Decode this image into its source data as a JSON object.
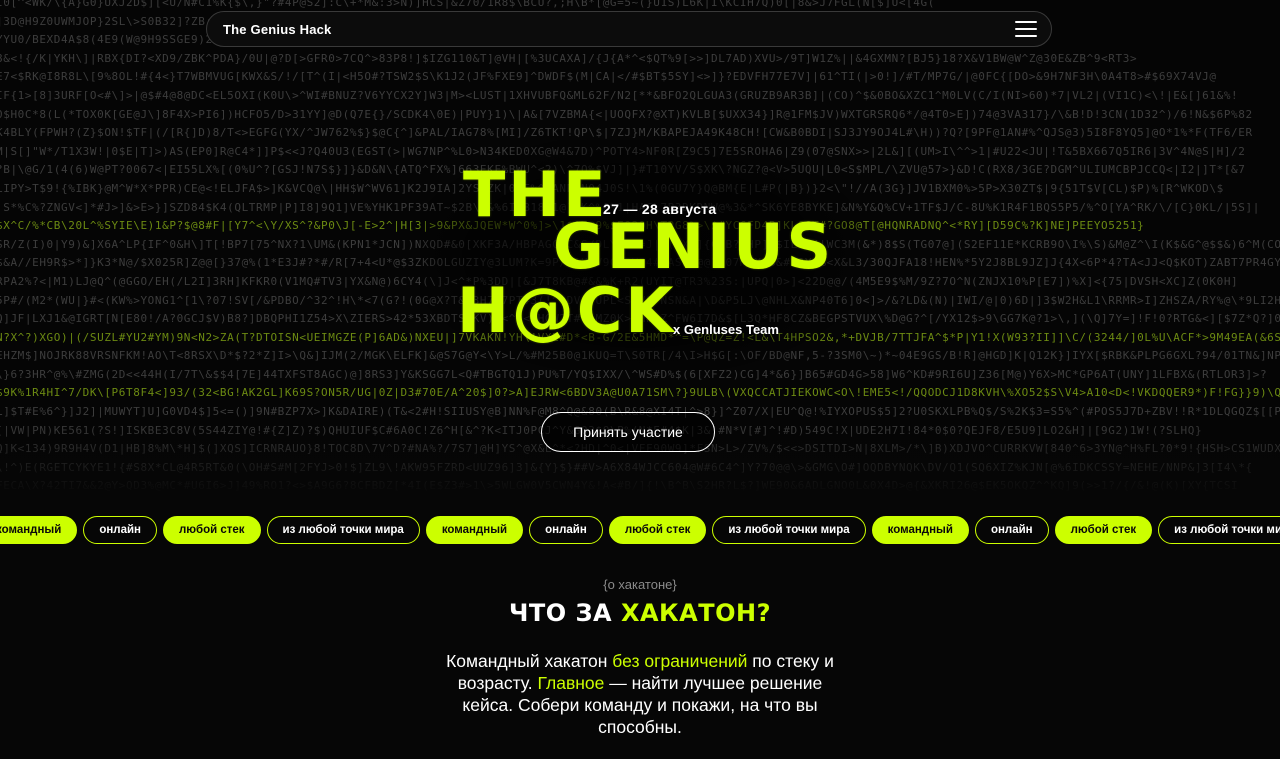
{
  "hero": {
    "matrix_lines": [
      "I0[^<WK/\\{A}G0}UXJ2D$][<U/N#C1%K{$\\,}\"?#4P@S2]:C\\+*M&:3>N)]HCS|&Z70/1R8$\\BCU?,;H\\B*[@G=5~(}U1S)L6K|I\\KCIH7Q)0[|8&>J7FGL(N[$]U<[4G(",
      "]3D@H9Z0UWMJOP}2SL\\>S0B32]?ZB;&!NF3\\&}@3W<XR\"7?1W\"<ZW\\1DD7L+%>R4}\\L%!?94#2D_J78*@OH)&{|2S;8H?C64&##B\\]W}K3#)QU8/]P$,<C<V%B7CD1XE]U{",
      "YYU0/BEXD4A$8(4E9(W@9H9SSGE9)2B<W%=[^U4!H&J8HGX\"@XF%<X%77|!\\%9>T;&@0[&N;8QE#&H5}=R4)@H(~80/P\\)@P/?0@<&>S08V!NCL17[3)7//0)UDH57MTS>",
      "8&<!{/K|YKH\\]|RBX{DI?<XD9/ZBK^PDA}/0U|@?D[>GFR0>7CQ^>83P8!]$IZG110&T]@VH|[%3UCAXA]/{J{A*^<$QT%9[>>]DL7AD)XVU>/9T]W1Z%||&4GXMN?[BJ5}18?X&V1BW@W^Z@30E&ZB^9<RT3>",
      "E7<$RK@I8R8L\\[9%8OL!#{4<}T7WBMVUG[KWX&S/!/[T^(I|<H5O#?TSW2$S\\K1J2(JF%FXE9]^DWDF$(M|CA|</#$BT$5SY]<>]}?EDVFH77E7V]|61^TI(|>0!]/#T/MP7G/|@0FC{[DO>&9H7NF3H\\0A4T8>#$69X74VJ@",
      "IF{1>[8]3URF[O<#\\]>|@$#4@8@DC<EL5OXI(K0U\\>^WI#BNUZ?V6YYCX2Y]W3|M><LUST|1XHVUBFQ&ML62F/N2[**&BFO2QLGUA3(GRUZB9AR3B]|(CO)^$&0BO&XZC1^M0LV(C/I(NI>60)*7|VL2|(VI1C)<\\!|E&[]61&%!",
      "0$H0C*8(L(*TOX0K[GE@J\\]8F4X>PI6])HCFO5/D>31YY]@D(Q7E{}/SCDK4\\0E)|PUY}1)\\|A&[7VZBMA{<|UOQFX?@XT)KVLB[$UXX34}]R@1FM$JV)WXTGRSRQ6*/@4T0>E])74@3VA317}/\\&B!D!3CN(1D32^)/6!N&$6P%82",
      "K4BLY(FPWH?(Z}$ON!$TF|(/[R{]D)8/T<>EGFG(YX/^JW762%$}$@C{^]&PAL/IAG78%[MI]/Z6TKT!QP\\$|7ZJ}M/KBAPEJA49K48CH![CW&B0BDI|SJ3JY9OJ4L#\\H))?Q?[9PF@1AN#%^QJS@3)5I8F8YQ5]@O*1%*F(TF6/ER",
      "M|S[]\"W*/T1X3W!|0$E|T]>)AS(EP0]R@C4*]]P$<<J?Q40U3(EGST(>|WG7NP^%L0>N34KED0XG@W4&7D)^POTY4>NF0R[Z9C5]7E5SROHA6|Z9(07@SNX>>|2L&][(UM>I\\^^>1|#U22<JU|!T&5BX667Q5IR6|3V^4N@S|H]/2",
      "?B|\\@G/1(4(6)W@PT?0067<|EI55LX%[(0%U^?[GSJ!N7S$}]}&D&N\\{ATQ^FX%]663EKF%BWU^<2)\\^7Q%$VJ]|}#T10YV/S$XK\\?NGZ?@<V>5UQU|L0<S$MPL/\\ZVU@57>}&D!C(RX8/3GE?DGM^ULIUMCBPJCCQ<|I2|]T*[&7",
      "LIPY>T$9!{%IBK}@M^W*X*PPR)CE@<!ELJFA$>]K&VCQ@\\|HH$W^WV61]K2J9IA]2YSDZK|03F%^&ANPVN04J0S!\\1%(0GU7Y}Q@BM{E|L#P(|B})}2<\\\"!//A(3G}]JV1BXM0%>5P>X30ZT$|9{51T$V[CL)$P)%[R^WKOD\\$",
      "|S*%C%?ZNGV<]*#J>]&>E>}]SZD84$K4(QLTRMP|P]I8]9Q1]VE%YHK1PF39AT~$2B\\7&%6I1B18C1@]AK^%0%1|HAC\\7B3DKDNW@%3&*^SK6YE8BYKE]&N%Y&Q%CV+1TF$J/C-8U%K1R4F1BQS5P5/%^O[YA^RK/\\/[C}0KL/|5S]|",
      "$X^C/%*CB\\20L^%SYIE\\E)1&P?$@8#F|[Y7^<\\Y/XS^?&P0\\J[-E>2^|H[3|>9&PX&JQEW*W^0%]>\\1$A7@9%$E02OH\\TRG8%>\\$#YC6FD4B]KLG6T#?GO8@T[@HQNRADNQ^<*RY][D59C%?K]NE]PEEYO5251}",
      "SR/Z(I)0|Y9)&]X6A^LP{IF^0&H\\]T[!BP7[75^NX?1\\UM&(KPN1*JCN])NXQD#&0[XKF3A/HBPAGCUC&S/DLYBRU=J|O(XXY]{CTB?(HP]U$IL8@4|WC3M(&*)8$S(TG07@](S2EF11E*KCRB9O\\I%\\S)&M@Z^\\I(K$&G^@$$&)6^M(CO5AO}",
      "$&A//EH9R$>*]}K3*N@/$X025R]Z@@[}37@%(1*E3J#?*#/R[7+4<U*@$3ZKDOLGUZIY@3LUM?K=9P/#&UMV9C@PV54#[ASEV@@?G07M}X@S&#M2Y@%<X&L3/30QJFA18!HEN%*5Y2J8BL9JZ]J{4X<6P*4?TA<JJ<Q$KOT)ZABT7PR4GYC]\\TI]Z|3SJZ",
      "RPA2%?<|M1)LJ@Q^(@GGO/EH(/L2I]3RH]KFKR0(V1MQ#TV3|YX&N@)6CY4(\\]J<^*P%3DD|[&J7T8KB@#&&%K+R2(UYIT@TR3%23S:|UPQ|0>]<22D@@/(4M5E9$%M/9Z?7O^N(ZNJX10%P[E7])%X]<{75|DVSH<XC]Z(0K0H]",
      "5P#/(M2*(WU|}#<(KW%>YONG1^[1\\?07!SV[/&PDBO/^32^!H\\*<7(G?!(0G@X?T&L3H7J7PT#3(!^*DV+)UPL<S8V9PNSN&A|\\D&P5LJ\\@NHLX&NP40T6]0<]>/&?LD&(N)|IWI/@|0)6D|]3$W2H&L1\\RRMR>I]ZHSZA/RY%@\\*9LI2H!",
      "Q]JF|LXJ1&@IGRT[N[E80!/A?0GCJ$V)B8?]DBQPHI1Z54>X\\ZIERS>42*53XBDTSHKV)9<^-<BHGW2T#Q(MZ0K>LH#]Z^FW6I7D&$[L3Q*HF8CZ&BEGPSTVUX\\%D@G?^[/YX12$>9\\GG7K@?1>\\,](\\Q]7Y=]!F!0?RTG&<][$7Z*Q?]02P{%<)>$C?C",
      "N?X^?)XGO)|(/SUZL#YU2#YM)9N<N2>ZA(T?DTOISN<UEIMGZE(P]6AD&)NXEU|]7VKAKN!YH\\!VXE#D*<B-G/2E&5HMD*^=\\P@QZ=Z!<L&\\T4HPSO2&,*+DVJB/7TTJFA^$*P|Y1!X(W93?II]]\\C/(3244/]0L%U\\ACF*>9M49EA(&6SR[L!]QGP)MCPB$Z(",
      "EHZM$]NOJRK88VRSNFKM!AO\\T<8RSX\\D*$?2*Z]I>\\Q&]IJM(2/MGK\\ELFK]&@S7G@Y<\\Y>L/%#M25B0@1KUQ=T\\S0TR[/4\\I>H$G[:\\OF/BD@NF,5-?3SM0\\~)*~04E9GS/B!R]@HGD]K|Q12K}]IYX[$RBK&PLPG6GXL?94/01TN&]NP(G4}EL]!{EK7E(OX/4P",
      "\\}6?3HR^@%\\#ZMG(2D<<44H(I/7T\\&$$4[7E]44TXFST8AGC)@]8RS3]Y&KSGG7L<Q#TBGTQ1J)PU%T/YQ$IXX/\\^WS#D%$(6[XFZ2)CG]4*&6}]B65#GD4G>58]W6^KD#9RI6U]Z36[M@)Y6X>MC*GP6AT(UNY]1LFBX&(RTLOR3]>?",
      "$9K%1R4HI^7/DK\\[P6T8F4<]93/(32<BG!AK2GL]K69S?ON5R/UG|0Z|D3#70E/A^20$]0?>A]EJRW<6BDV3A@U0A71SM\\?}9ULB\\(VXQCCATJIEKOWC<O\\!EME5<!/QQODCJ1D8KVH\\%XO52$S\\V4>A10<D<!VKDQQER9*)F!FG}}9)\\Q?P",
      "L]$T#E%6^}]J2]|MUWYT]U]G0VD4$]5<=()]9N#BZP7X>]K&DAIRE)(T&<2#H!SIIUSY@B]NN%F@M8^Q@&80(B\\R&8@XI4T|^>8}]^Z07/X|EU^Q@!%IYXOPUS$5]2?U0SKXLPB%Q$/S%2K$3=S5%^(#POS5J7D+ZBV!!R*1DLQGQZ$[[PHD(]",
      "[|VW|PN)KE561(?S!]ISKBE3C8V(5S44ZIY@!#{Z]Z)?$)QHUIUF$C#6A0C!Z6^H[&^?K<ITJ0PCJ^Y&GO3$Q\\P%(N*E#4$K|3&!#N*V[#]^!#D)549C!X|UDE2H7I!84*0$0?QEJF8/E5U9]LO2&H]|[9G2)1W!(?SLHQ}",
      "Q]K<134)9R9H4V(D1|HB]8%M\\*H]$(]XQS]ICRNRAUO}8!TOC8D\\7V^D?#NA%?/7S7]@H]YS^@X&L^*<?HD|^0<|VFF90W9]*FSN>L>/ZV%/$<<>DSITDI>N|8XLM>/*\\]B)XDJVO^CURRKVW[840^6>3YN@^H%FL?0*9!{HSH>CS1WUDXW",
      "\\!^)E(RGETCYKYE1!{#S8X*CL@4R5RT&0(\\OH#S#M[2FYJ>0!$]ZL9\\!AKW95FZRD<UUZ96]3]&{Y}$}##V>A6X84WJCC604@W#6C4^]Y?70@@\\>&GMG\\O#]OQDBYNQK\\DV/Q1(SQ6XIZ%KJN[@%6IDKCSSY=NEHE/NNP&]3[I4\\*{",
      "FECA\\X?42TI7&&2@Y>QD3%@MC*#U6I6>J]49%RO1?<>$A9G6?8CFBDZ[*4I(E$Z3#>1\\>5WLGW0V5CWN4Y&!A<#B/]{!\\B^B\\S2HR?L$?]WE90&6ADLGNO0L&0X4D>@{&XKRI26@$EK5OKQZ^^KQ]9(>>1?/{/&!@(K)[XY{TCSI",
      "Z%M&E)Y)0|/U3XX4@4HUASH&\\92]4OL!&P@@JDWU)/XV8GM8<F8II7!U[!WCFWS\\<JZL]?^54P[(5@JWRC]14E]$5[SZ]%[[FN05TE|8[S31!<YQK]EB)6\\#TP]$/ESIZ1ZAM<(DNQ*<C]@00@L)!GBFMFY#0!E/C<(|[%*&\\M*YH",
      "^%%SW}@SSVLJC8EMRJU626QN>?T!K\\ONRKM3#BI3@7DG|8K*&A@\\7)D#1BF/48PU&#)NLKX%D)T>M(G%O$B(U$TV[4MD0431B[?7Z1/2PIGRMB30(<[4<0!%J0<<A7%G@B&H]>JA^P5FV]GO*?4(0FVP\\&4B^3VF#UQK39ER$*/V*$",
      "A\\A4D*]VIN*$8K7{/A8Z(?L^A[QH%%@@GVV8^^?D4G]7MII[C@73I85XGJ716XU2NP/VY$G|K@0G-E2DS3RIX3XXJ62]FUR96(X3EBWY@RLMC4@#VM[TA&GQJ@>(0\\?[H(&GW]]M[05U?HKQVQ(?KW9N8>]WQFLSD&PW^YQ(#&QL)%3@$E",
      "JITGZZLBIM]3*87MZ]{/J{YM!S%NVQB%7UO@^OP@@U%X11HR2YV04G%07%(1TPUFP4[GMMWD\\4IU{FG\\NQ}<YNW\\Q<(ZX2$[[1@/$LUP<\\0[[3]]]|BD(13?$H]KN209?7(|XO329VDWS}?W<XXPVZ^>>S3)RM2IXV@TH?<4]!V6P]/\\^*24?",
      "@<ID!GS>\\\\GJQ0%$S|8>)|XPQ]89C%M#?J6O7I(/4]CN9]/6%?IL8/VO[W%ZGM[J2#$|C{F?F!@S4*<%L@%]8{C3]\\\\5U[Q]2&7!Y]V*%/\\K(L{Z3@?R6|BM>F25VOK&#>>AXL*8S18%KIT4$?@G?X&Z%P29[K$%CD>]Y@TM|SU8(Z{#XF|K0S",
      "RT6^/5?*V]KBY?#VNIR?D[[KP]8C8DFK]4G7YJP4Z!1%]6F]O[C]!DCF/F]G#39UF]IX9]>%&%WS0]J]Y(TDD/ANXH3UWUE3]}]&K(06N><]/@N)[*L%!AT^ORPLTMA?H?C]Z6/NL6RLQ(OPFMYRF]}(C9)S8HCSG9?PI?(*6\\?|",
      "$18/3WQ]|%$APFAPY(I\\T]6W/AO[B}>]50[KLAZ9]RAV3\\ON)T9PFV[N?@Y4!%]0HPM]X&9@AD]$%W(X%2Y20S<>5/3OT[2RWSM8S5]/9JKO2S{YXH7(UFT]$2[ZC4UT]29??ZWSHQL7P\\ZMY/4<8]?D(AJE96?&|KHHSLRTQU7F"
    ],
    "highlight_lines": [
      12,
      18,
      21,
      27,
      31,
      32
    ]
  },
  "nav": {
    "title": "The Genius Hack",
    "menu_icon": "hamburger-menu-icon"
  },
  "logo": {
    "line1": "THE",
    "line2": "GENIUS",
    "line3": "H@CK",
    "date": "27 — 28 августа",
    "team": "x Genluses Team"
  },
  "cta": {
    "label": "Принять участие"
  },
  "tags": [
    {
      "label": "командный",
      "filled": true
    },
    {
      "label": "онлайн",
      "filled": false
    },
    {
      "label": "любой стек",
      "filled": true
    },
    {
      "label": "из любой точки мира",
      "filled": false
    },
    {
      "label": "командный",
      "filled": true
    },
    {
      "label": "онлайн",
      "filled": false
    },
    {
      "label": "любой стек",
      "filled": true
    },
    {
      "label": "из любой точки мира",
      "filled": false
    },
    {
      "label": "командный",
      "filled": true
    },
    {
      "label": "онлайн",
      "filled": false
    },
    {
      "label": "любой стек",
      "filled": true
    },
    {
      "label": "из любой точки мира",
      "filled": false
    }
  ],
  "about": {
    "kicker": "{о хакатоне}",
    "title_plain": "ЧТО ЗА ",
    "title_accent": "ХАКАТОН?",
    "text_1": "Командный хакатон ",
    "text_accent_1": "без ограничений",
    "text_2": " по стеку и возрасту. ",
    "text_accent_2": "Главное",
    "text_3": " — найти лучшее решение кейса. Собери команду и покажи, на что вы способны."
  },
  "colors": {
    "accent": "#ccff00",
    "background": "#060606",
    "matrix_text": "#3d3d3d"
  }
}
